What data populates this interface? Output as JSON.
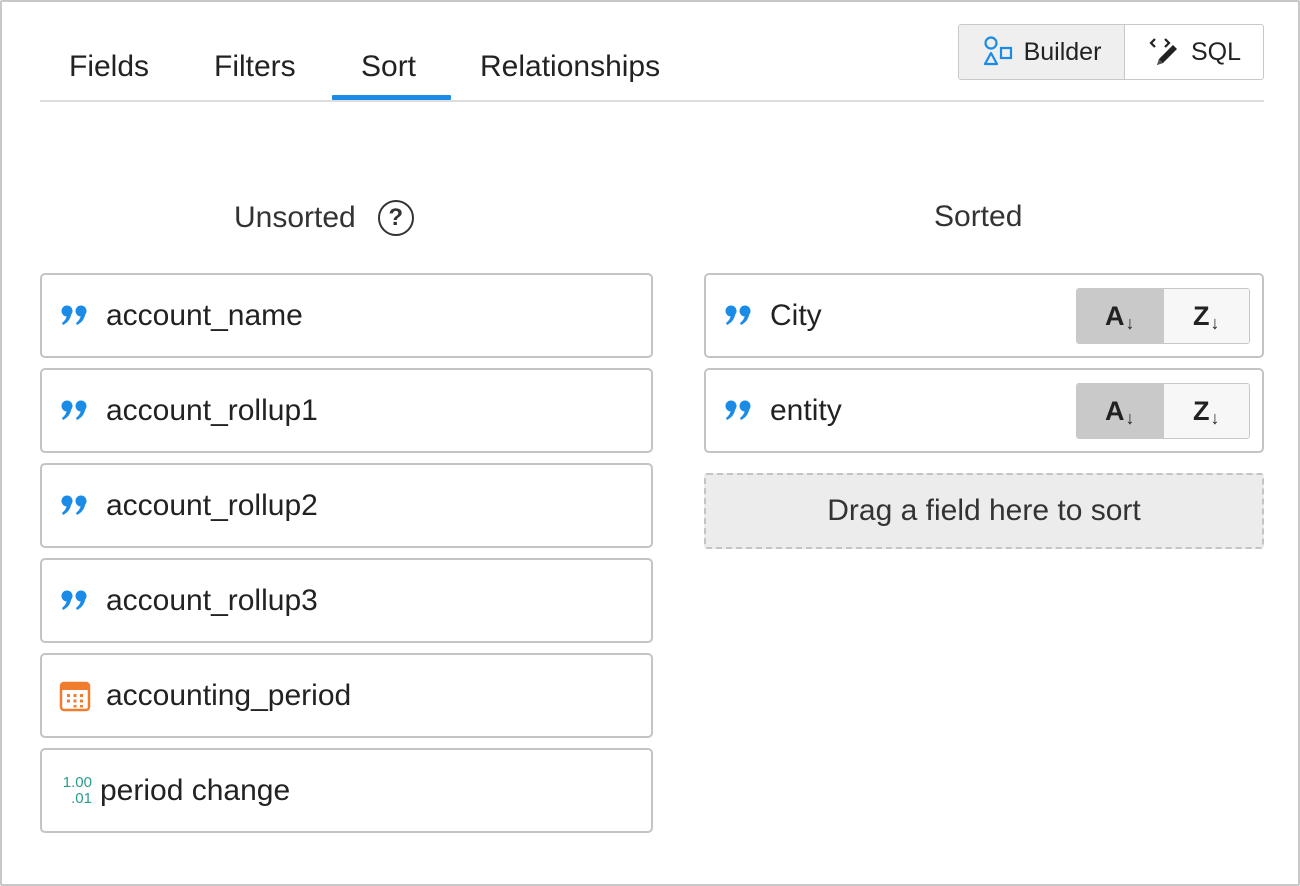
{
  "tabs": [
    {
      "label": "Fields"
    },
    {
      "label": "Filters"
    },
    {
      "label": "Sort"
    },
    {
      "label": "Relationships"
    }
  ],
  "active_tab": "Sort",
  "mode_toggle": {
    "builder_label": "Builder",
    "sql_label": "SQL",
    "active": "Builder"
  },
  "unsorted": {
    "heading": "Unsorted",
    "help_glyph": "?",
    "fields": [
      {
        "label": "account_name",
        "type_icon": "quote-icon"
      },
      {
        "label": "account_rollup1",
        "type_icon": "quote-icon"
      },
      {
        "label": "account_rollup2",
        "type_icon": "quote-icon"
      },
      {
        "label": "account_rollup3",
        "type_icon": "quote-icon"
      },
      {
        "label": "accounting_period",
        "type_icon": "calendar-icon"
      },
      {
        "label": "period change",
        "type_icon": "number-icon",
        "icon_text_top": "1.00",
        "icon_text_bottom": ".01"
      }
    ]
  },
  "sorted": {
    "heading": "Sorted",
    "fields": [
      {
        "label": "City",
        "type_icon": "quote-icon",
        "asc_label": "A",
        "desc_label": "Z",
        "direction": "asc"
      },
      {
        "label": "entity",
        "type_icon": "quote-icon",
        "asc_label": "A",
        "desc_label": "Z",
        "direction": "asc"
      }
    ],
    "drop_zone_text": "Drag a field here to sort"
  },
  "colors": {
    "accent": "#1a8be6",
    "calendar": "#f07d2e",
    "number": "#2a9d8f"
  }
}
